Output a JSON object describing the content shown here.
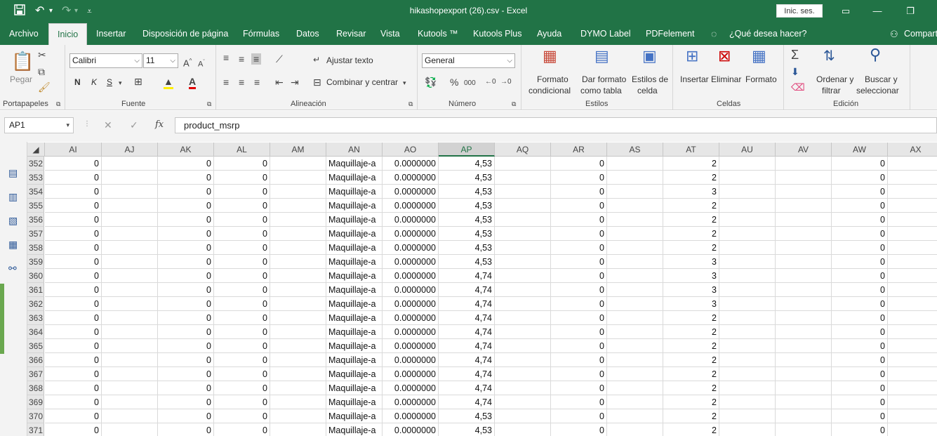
{
  "window": {
    "title": "hikashopexport (26).csv  -  Excel",
    "signin_label": "Inic. ses."
  },
  "tabs": [
    "Archivo",
    "Inicio",
    "Insertar",
    "Disposición de página",
    "Fórmulas",
    "Datos",
    "Revisar",
    "Vista",
    "Kutools ™",
    "Kutools Plus",
    "Ayuda",
    "DYMO Label",
    "PDFelement",
    "¿Qué desea hacer?",
    "Compart"
  ],
  "ribbon": {
    "portapapeles": {
      "paste_label": "Pegar",
      "group": "Portapapeles"
    },
    "fuente": {
      "font_name": "Calibri",
      "font_size": "11",
      "bold": "N",
      "italic": "K",
      "underline": "S",
      "group": "Fuente"
    },
    "alineacion": {
      "wrap": "Ajustar texto",
      "merge": "Combinar y centrar",
      "group": "Alineación"
    },
    "numero": {
      "format": "General",
      "group": "Número"
    },
    "estilos": {
      "cond_1": "Formato",
      "cond_2": "condicional",
      "table_1": "Dar formato",
      "table_2": "como tabla",
      "cell_1": "Estilos de",
      "cell_2": "celda",
      "group": "Estilos"
    },
    "celdas": {
      "insert": "Insertar",
      "delete": "Eliminar",
      "format": "Formato",
      "group": "Celdas"
    },
    "edicion": {
      "sort_1": "Ordenar y",
      "sort_2": "filtrar",
      "find_1": "Buscar y",
      "find_2": "seleccionar",
      "group": "Edición"
    }
  },
  "formula_bar": {
    "name_box": "AP1",
    "content": "product_msrp"
  },
  "sheet": {
    "columns": [
      "AI",
      "AJ",
      "AK",
      "AL",
      "AM",
      "AN",
      "AO",
      "AP",
      "AQ",
      "AR",
      "AS",
      "AT",
      "AU",
      "AV",
      "AW",
      "AX"
    ],
    "selected_column": "AP",
    "rows": [
      {
        "n": "352",
        "ai": "0",
        "ak": "0",
        "al": "0",
        "an": "Maquillaje-a",
        "ao": "0.0000000",
        "ap": "4,53",
        "ar": "0",
        "at": "2",
        "aw": "0"
      },
      {
        "n": "353",
        "ai": "0",
        "ak": "0",
        "al": "0",
        "an": "Maquillaje-a",
        "ao": "0.0000000",
        "ap": "4,53",
        "ar": "0",
        "at": "2",
        "aw": "0"
      },
      {
        "n": "354",
        "ai": "0",
        "ak": "0",
        "al": "0",
        "an": "Maquillaje-a",
        "ao": "0.0000000",
        "ap": "4,53",
        "ar": "0",
        "at": "3",
        "aw": "0"
      },
      {
        "n": "355",
        "ai": "0",
        "ak": "0",
        "al": "0",
        "an": "Maquillaje-a",
        "ao": "0.0000000",
        "ap": "4,53",
        "ar": "0",
        "at": "2",
        "aw": "0"
      },
      {
        "n": "356",
        "ai": "0",
        "ak": "0",
        "al": "0",
        "an": "Maquillaje-a",
        "ao": "0.0000000",
        "ap": "4,53",
        "ar": "0",
        "at": "2",
        "aw": "0"
      },
      {
        "n": "357",
        "ai": "0",
        "ak": "0",
        "al": "0",
        "an": "Maquillaje-a",
        "ao": "0.0000000",
        "ap": "4,53",
        "ar": "0",
        "at": "2",
        "aw": "0"
      },
      {
        "n": "358",
        "ai": "0",
        "ak": "0",
        "al": "0",
        "an": "Maquillaje-a",
        "ao": "0.0000000",
        "ap": "4,53",
        "ar": "0",
        "at": "2",
        "aw": "0"
      },
      {
        "n": "359",
        "ai": "0",
        "ak": "0",
        "al": "0",
        "an": "Maquillaje-a",
        "ao": "0.0000000",
        "ap": "4,53",
        "ar": "0",
        "at": "3",
        "aw": "0"
      },
      {
        "n": "360",
        "ai": "0",
        "ak": "0",
        "al": "0",
        "an": "Maquillaje-a",
        "ao": "0.0000000",
        "ap": "4,74",
        "ar": "0",
        "at": "3",
        "aw": "0"
      },
      {
        "n": "361",
        "ai": "0",
        "ak": "0",
        "al": "0",
        "an": "Maquillaje-a",
        "ao": "0.0000000",
        "ap": "4,74",
        "ar": "0",
        "at": "3",
        "aw": "0"
      },
      {
        "n": "362",
        "ai": "0",
        "ak": "0",
        "al": "0",
        "an": "Maquillaje-a",
        "ao": "0.0000000",
        "ap": "4,74",
        "ar": "0",
        "at": "3",
        "aw": "0"
      },
      {
        "n": "363",
        "ai": "0",
        "ak": "0",
        "al": "0",
        "an": "Maquillaje-a",
        "ao": "0.0000000",
        "ap": "4,74",
        "ar": "0",
        "at": "2",
        "aw": "0"
      },
      {
        "n": "364",
        "ai": "0",
        "ak": "0",
        "al": "0",
        "an": "Maquillaje-a",
        "ao": "0.0000000",
        "ap": "4,74",
        "ar": "0",
        "at": "2",
        "aw": "0"
      },
      {
        "n": "365",
        "ai": "0",
        "ak": "0",
        "al": "0",
        "an": "Maquillaje-a",
        "ao": "0.0000000",
        "ap": "4,74",
        "ar": "0",
        "at": "2",
        "aw": "0"
      },
      {
        "n": "366",
        "ai": "0",
        "ak": "0",
        "al": "0",
        "an": "Maquillaje-a",
        "ao": "0.0000000",
        "ap": "4,74",
        "ar": "0",
        "at": "2",
        "aw": "0"
      },
      {
        "n": "367",
        "ai": "0",
        "ak": "0",
        "al": "0",
        "an": "Maquillaje-a",
        "ao": "0.0000000",
        "ap": "4,74",
        "ar": "0",
        "at": "2",
        "aw": "0"
      },
      {
        "n": "368",
        "ai": "0",
        "ak": "0",
        "al": "0",
        "an": "Maquillaje-a",
        "ao": "0.0000000",
        "ap": "4,74",
        "ar": "0",
        "at": "2",
        "aw": "0"
      },
      {
        "n": "369",
        "ai": "0",
        "ak": "0",
        "al": "0",
        "an": "Maquillaje-a",
        "ao": "0.0000000",
        "ap": "4,74",
        "ar": "0",
        "at": "2",
        "aw": "0"
      },
      {
        "n": "370",
        "ai": "0",
        "ak": "0",
        "al": "0",
        "an": "Maquillaje-a",
        "ao": "0.0000000",
        "ap": "4,53",
        "ar": "0",
        "at": "2",
        "aw": "0"
      },
      {
        "n": "371",
        "ai": "0",
        "ak": "0",
        "al": "0",
        "an": "Maquillaje-a",
        "ao": "0.0000000",
        "ap": "4,53",
        "ar": "0",
        "at": "2",
        "aw": "0"
      }
    ]
  },
  "colors": {
    "excel_green": "#217346",
    "ribbon_bg": "#f3f3f3"
  }
}
